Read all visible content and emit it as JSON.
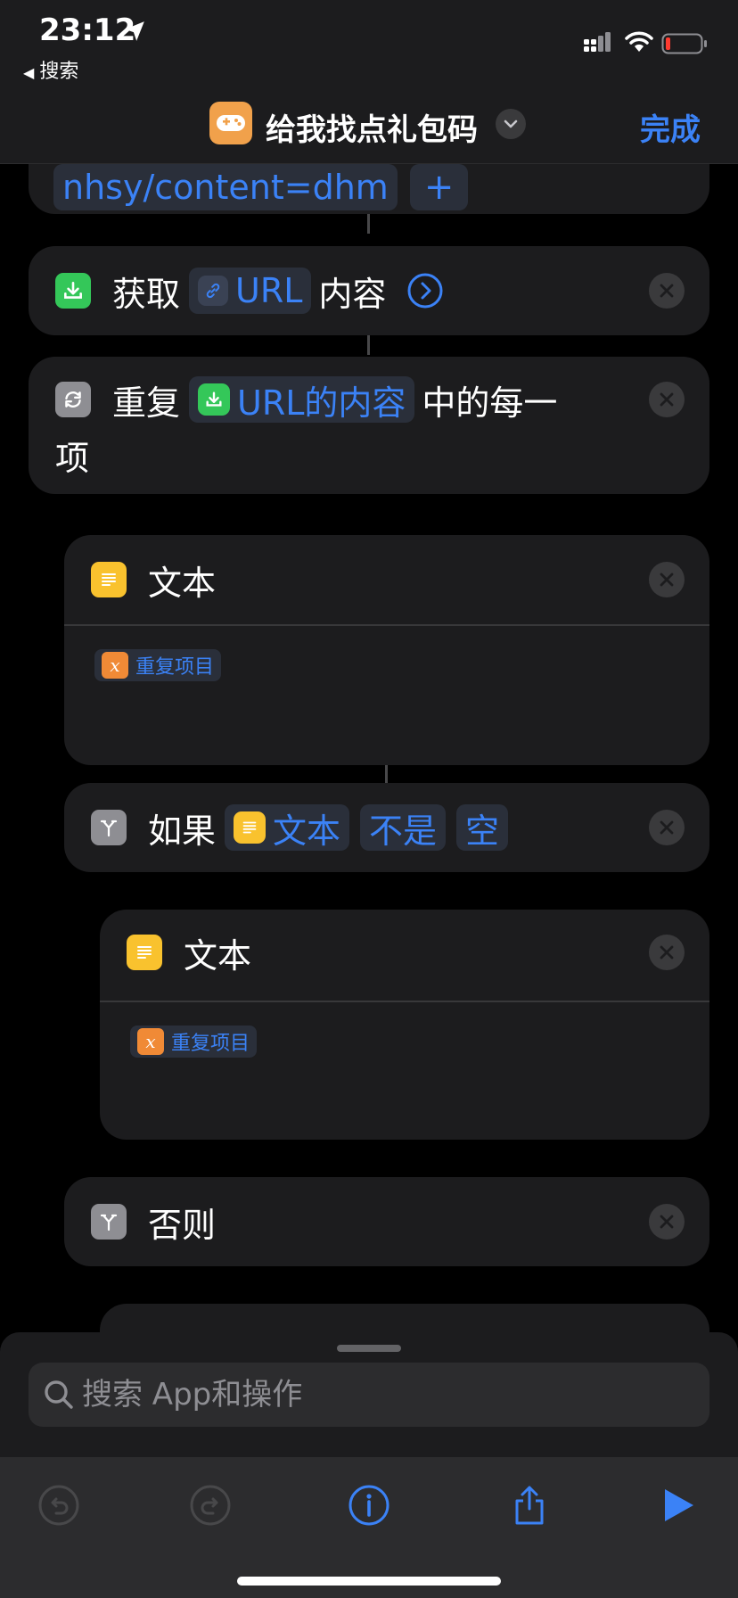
{
  "status": {
    "time": "23:12",
    "back_label": "搜索"
  },
  "nav": {
    "title": "给我找点礼包码",
    "done_label": "完成"
  },
  "actions": {
    "url_card": {
      "url_tail": "nhsy/content=dhm",
      "add_label": "+"
    },
    "get_contents": {
      "verb": "获取",
      "token": "URL",
      "suffix": "内容"
    },
    "repeat": {
      "verb": "重复",
      "token": "URL的内容",
      "suffix": "中的每一",
      "wrap": "项"
    },
    "text1": {
      "title": "文本",
      "var_token": "重复项目"
    },
    "if": {
      "verb": "如果",
      "token_text": "文本",
      "token_condition": "不是",
      "token_value": "空"
    },
    "text2": {
      "title": "文本",
      "var_token": "重复项目"
    },
    "otherwise": {
      "label": "否则"
    }
  },
  "search": {
    "placeholder": "搜索 App和操作"
  },
  "icons": {
    "location": "location-arrow-icon",
    "signal": "cellular-signal-icon",
    "wifi": "wifi-icon",
    "battery": "battery-low-icon",
    "app": "gamepad-icon",
    "download": "download-icon",
    "repeat": "repeat-icon",
    "text": "text-lines-icon",
    "branch": "branch-icon",
    "variable": "variable-icon",
    "undo": "undo-icon",
    "redo": "redo-icon",
    "info": "info-icon",
    "share": "share-icon",
    "play": "play-icon"
  },
  "colors": {
    "accent": "#3b82f6",
    "green": "#34c759",
    "yellow": "#f9c22e",
    "orange": "#f08a36",
    "battery_low": "#ff3b30"
  }
}
